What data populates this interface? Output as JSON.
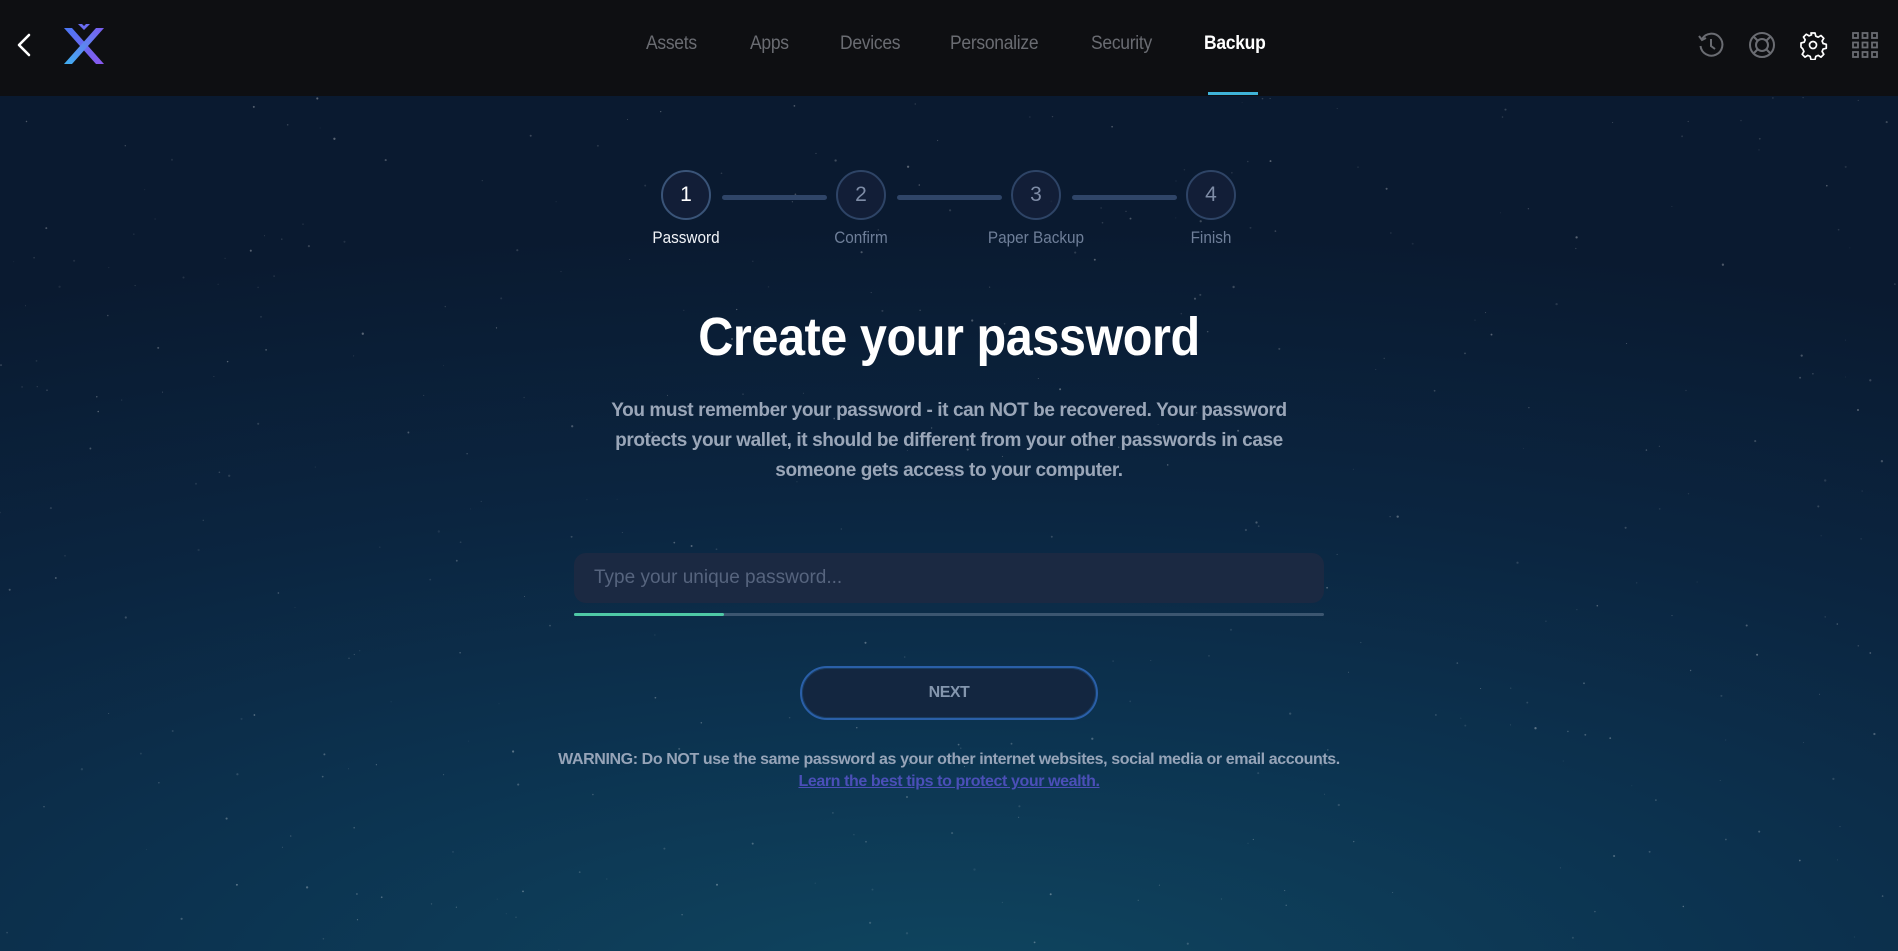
{
  "header": {
    "back_label": "Back",
    "logo": "exodus-logo",
    "nav": [
      {
        "label": "Assets",
        "active": false
      },
      {
        "label": "Apps",
        "active": false
      },
      {
        "label": "Devices",
        "active": false
      },
      {
        "label": "Personalize",
        "active": false
      },
      {
        "label": "Security",
        "active": false
      },
      {
        "label": "Backup",
        "active": true
      }
    ],
    "right_icons": [
      "history-icon",
      "help-lifebuoy-icon",
      "settings-gear-icon",
      "apps-grid-icon"
    ],
    "accent_color": "#3fb3d8"
  },
  "stepper": {
    "steps": [
      {
        "number": "1",
        "label": "Password",
        "active": true
      },
      {
        "number": "2",
        "label": "Confirm",
        "active": false
      },
      {
        "number": "3",
        "label": "Paper Backup",
        "active": false
      },
      {
        "number": "4",
        "label": "Finish",
        "active": false
      }
    ]
  },
  "main": {
    "title": "Create your password",
    "description": "You must remember your password - it can NOT be recovered. Your password protects your wallet, it should be different from your other passwords in case someone gets access to your computer.",
    "password_input": {
      "value": "",
      "placeholder": "Type your unique password..."
    },
    "strength": {
      "fraction": 0.2,
      "color": "#4fc9a6"
    },
    "next_label": "NEXT",
    "warning": "WARNING: Do NOT use the same password as your other internet websites, social media or email accounts.",
    "tips_link": "Learn the best tips to protect your wealth."
  }
}
